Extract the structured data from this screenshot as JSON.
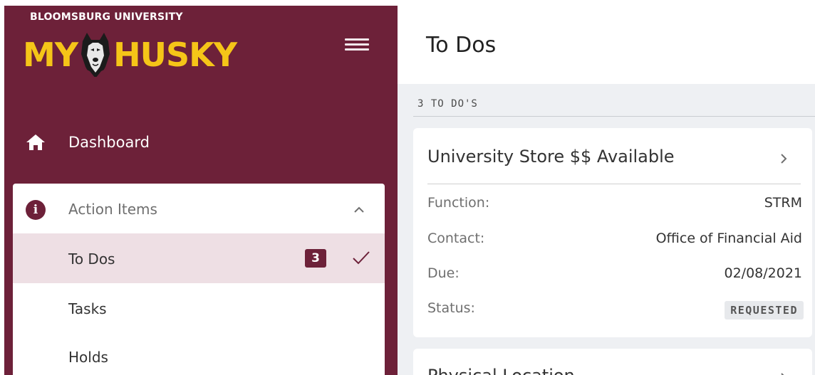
{
  "brand": {
    "university": "BLOOMSBURG UNIVERSITY",
    "my": "MY",
    "husky": "HUSKY",
    "logo_icon": "husky-mascot-icon"
  },
  "colors": {
    "sidebar_bg": "#6d2139",
    "brand_gold": "#f5c518",
    "active_item_bg": "#eedfe4",
    "content_bg": "#eef0f3"
  },
  "sidebar": {
    "menu_icon": "hamburger-icon",
    "dashboard": {
      "label": "Dashboard",
      "icon": "home-icon"
    },
    "action_items": {
      "label": "Action Items",
      "icon": "info-icon",
      "info_glyph": "i",
      "expanded": true,
      "items": [
        {
          "label": "To Dos",
          "badge": "3",
          "active": true
        },
        {
          "label": "Tasks"
        },
        {
          "label": "Holds"
        }
      ]
    }
  },
  "main": {
    "title": "To Dos",
    "count_label": "3 TO DO'S",
    "cards": [
      {
        "title": "University Store $$ Available",
        "fields": [
          {
            "label": "Function:",
            "value": "STRM"
          },
          {
            "label": "Contact:",
            "value": "Office of Financial Aid"
          },
          {
            "label": "Due:",
            "value": "02/08/2021"
          },
          {
            "label": "Status:",
            "value": "REQUESTED"
          }
        ]
      },
      {
        "title": "Physical Location"
      }
    ]
  }
}
